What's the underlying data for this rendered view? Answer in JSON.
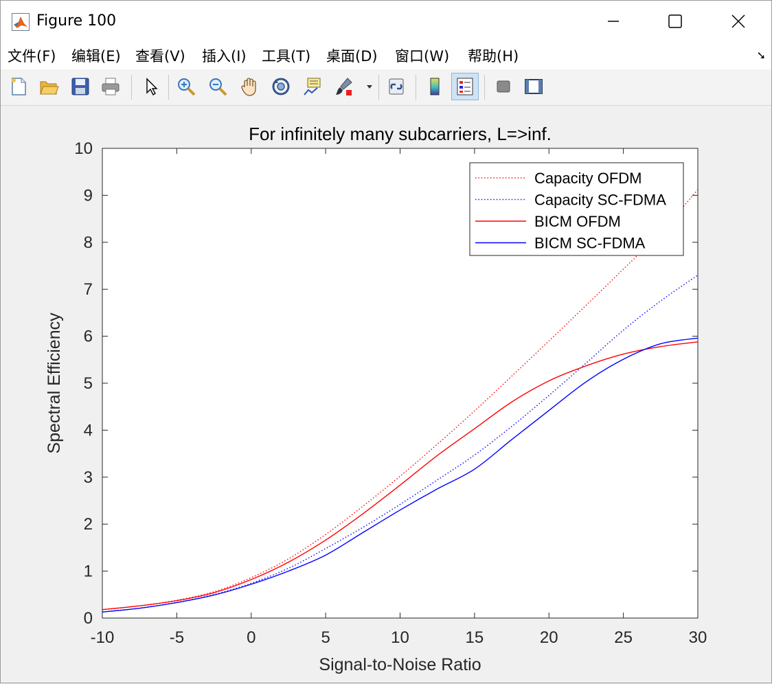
{
  "window": {
    "title": "Figure 100",
    "controls": [
      "minimize",
      "maximize",
      "close"
    ]
  },
  "menubar": {
    "items": [
      {
        "label": "文件(F)",
        "underline": "F"
      },
      {
        "label": "编辑(E)",
        "underline": "E"
      },
      {
        "label": "查看(V)",
        "underline": "V"
      },
      {
        "label": "插入(I)",
        "underline": "I"
      },
      {
        "label": "工具(T)",
        "underline": "T"
      },
      {
        "label": "桌面(D)",
        "underline": "D"
      },
      {
        "label": "窗口(W)",
        "underline": "W"
      },
      {
        "label": "帮助(H)",
        "underline": "H"
      }
    ],
    "overflow_icon": "dock-arrow-icon"
  },
  "toolbar": {
    "buttons": [
      {
        "name": "new-figure",
        "icon": "new-document-icon"
      },
      {
        "name": "open-file",
        "icon": "folder-open-icon"
      },
      {
        "name": "save-figure",
        "icon": "floppy-disk-icon"
      },
      {
        "name": "print-figure",
        "icon": "printer-icon"
      },
      {
        "name": "edit-plot",
        "icon": "pointer-arrow-icon"
      },
      {
        "name": "zoom-in",
        "icon": "zoom-in-icon"
      },
      {
        "name": "zoom-out",
        "icon": "zoom-out-icon"
      },
      {
        "name": "pan",
        "icon": "hand-icon"
      },
      {
        "name": "rotate-3d",
        "icon": "rotate-3d-icon"
      },
      {
        "name": "data-cursor",
        "icon": "data-tip-icon"
      },
      {
        "name": "brush",
        "icon": "brush-icon"
      },
      {
        "name": "link-plot",
        "icon": "link-plot-icon"
      },
      {
        "name": "colorbar",
        "icon": "colorbar-icon"
      },
      {
        "name": "legend",
        "icon": "legend-icon",
        "active": true
      },
      {
        "name": "hide-plot-tools",
        "icon": "hide-plot-tools-icon"
      },
      {
        "name": "show-plot-tools",
        "icon": "show-plot-tools-icon"
      }
    ]
  },
  "colors": {
    "ofdm": "#ff0000",
    "scfdma": "#0000ff",
    "axes_background": "#ffffff",
    "figure_background": "#f0f0f0"
  },
  "chart_data": {
    "type": "line",
    "title": "For infinitely many subcarriers, L=>inf.",
    "xlabel": "Signal-to-Noise Ratio",
    "ylabel": "Spectral Efficiency",
    "xlim": [
      -10,
      30
    ],
    "ylim": [
      0,
      10
    ],
    "xticks": [
      -10,
      -5,
      0,
      5,
      10,
      15,
      20,
      25,
      30
    ],
    "yticks": [
      0,
      1,
      2,
      3,
      4,
      5,
      6,
      7,
      8,
      9,
      10
    ],
    "grid": false,
    "legend_position": "top-right",
    "x": [
      -10,
      -7.5,
      -5,
      -2.5,
      0,
      2.5,
      5,
      7.5,
      10,
      12.5,
      15,
      17.5,
      20,
      22.5,
      25,
      27.5,
      30
    ],
    "series": [
      {
        "name": "Capacity OFDM",
        "style": "dotted",
        "color": "#ff0000",
        "values": [
          0.18,
          0.26,
          0.38,
          0.56,
          0.86,
          1.26,
          1.78,
          2.38,
          3.02,
          3.7,
          4.41,
          5.15,
          5.9,
          6.66,
          7.43,
          8.21,
          9.12
        ]
      },
      {
        "name": "Capacity SC-FDMA",
        "style": "dotted",
        "color": "#0000ff",
        "values": [
          0.13,
          0.21,
          0.33,
          0.5,
          0.74,
          1.06,
          1.48,
          1.93,
          2.42,
          2.94,
          3.47,
          4.08,
          4.74,
          5.43,
          6.13,
          6.75,
          7.3
        ]
      },
      {
        "name": "BICM OFDM",
        "style": "solid",
        "color": "#ff0000",
        "values": [
          0.18,
          0.26,
          0.37,
          0.54,
          0.82,
          1.19,
          1.66,
          2.22,
          2.83,
          3.46,
          4.03,
          4.6,
          5.05,
          5.37,
          5.62,
          5.78,
          5.88
        ]
      },
      {
        "name": "BICM SC-FDMA",
        "style": "solid",
        "color": "#0000ff",
        "values": [
          0.13,
          0.21,
          0.33,
          0.49,
          0.72,
          1.0,
          1.34,
          1.82,
          2.3,
          2.75,
          3.17,
          3.8,
          4.42,
          5.03,
          5.51,
          5.84,
          5.96
        ]
      }
    ]
  }
}
